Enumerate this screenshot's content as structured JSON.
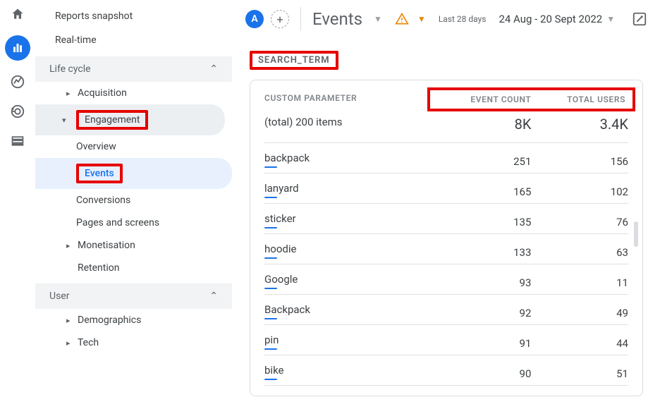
{
  "rail": {
    "avatar_letter": "A"
  },
  "sidebar": {
    "snapshot": "Reports snapshot",
    "realtime": "Real-time",
    "lifecycle_label": "Life cycle",
    "acquisition": "Acquisition",
    "engagement": "Engagement",
    "overview": "Overview",
    "events": "Events",
    "conversions": "Conversions",
    "pages": "Pages and screens",
    "monetisation": "Monetisation",
    "retention": "Retention",
    "user_label": "User",
    "demographics": "Demographics",
    "tech": "Tech"
  },
  "header": {
    "page_title": "Events",
    "period_label": "Last 28 days",
    "date_range": "24 Aug - 20 Sept 2022",
    "add_label": "+"
  },
  "card": {
    "title": "SEARCH_TERM",
    "col_param": "CUSTOM PARAMETER",
    "col_count": "EVENT COUNT",
    "col_users": "TOTAL USERS",
    "total_label": "(total) 200 items",
    "total_count": "8K",
    "total_users": "3.4K",
    "rows": [
      {
        "param": "backpack",
        "count": "251",
        "users": "156"
      },
      {
        "param": "lanyard",
        "count": "165",
        "users": "102"
      },
      {
        "param": "sticker",
        "count": "135",
        "users": "76"
      },
      {
        "param": "hoodie",
        "count": "133",
        "users": "63"
      },
      {
        "param": "Google",
        "count": "93",
        "users": "11"
      },
      {
        "param": "Backpack",
        "count": "92",
        "users": "49"
      },
      {
        "param": "pin",
        "count": "91",
        "users": "44"
      },
      {
        "param": "bike",
        "count": "90",
        "users": "51"
      }
    ]
  }
}
